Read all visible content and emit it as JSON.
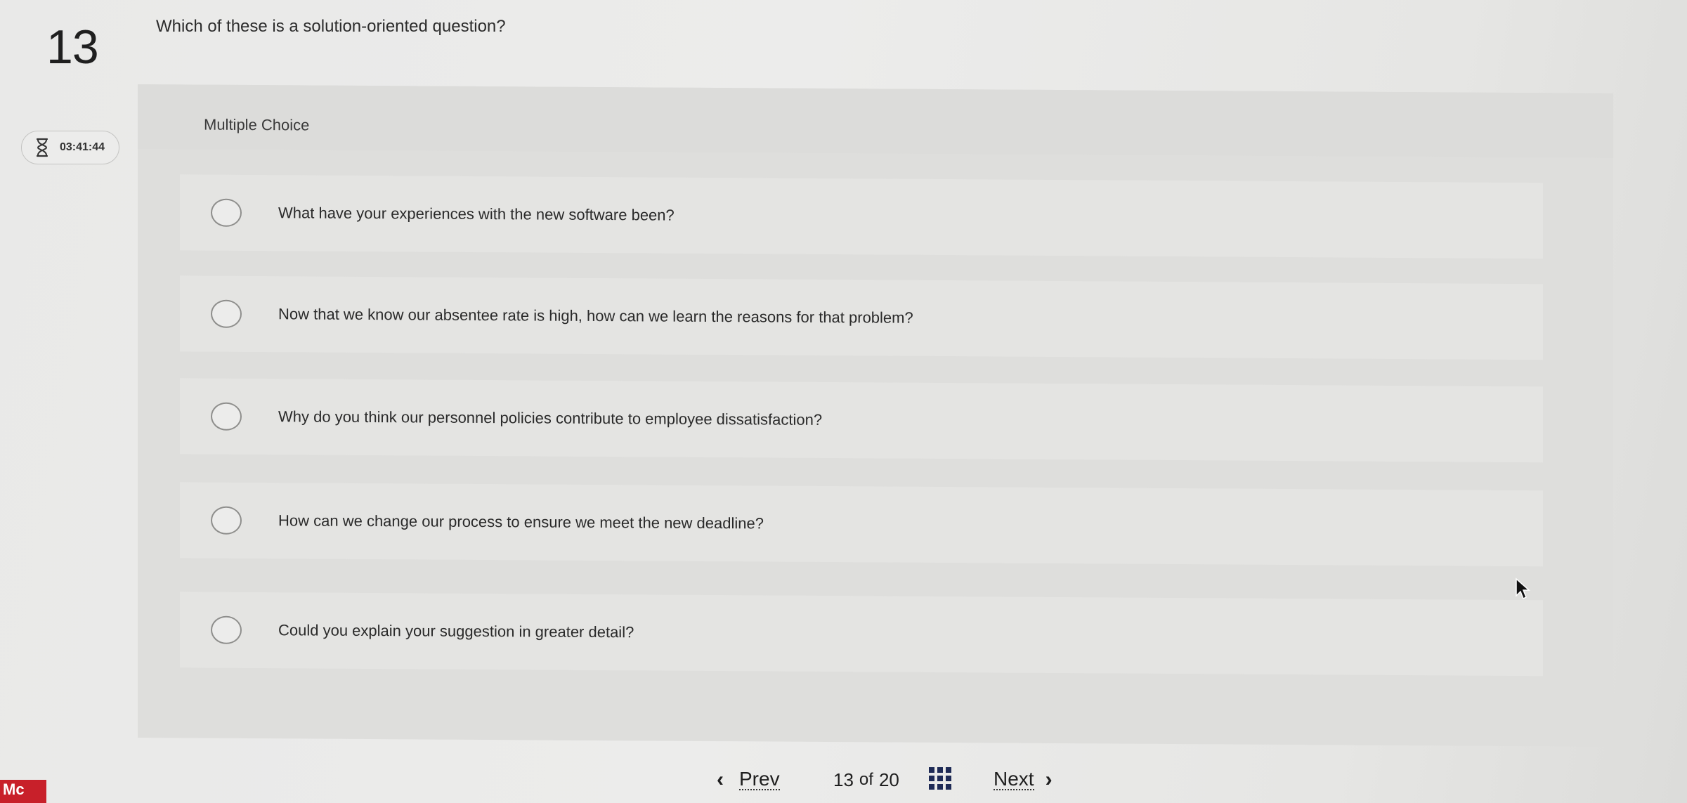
{
  "question": {
    "number": "13",
    "text": "Which of these is a solution-oriented question?"
  },
  "timer": {
    "icon": "hourglass-icon",
    "time": "03:41:44"
  },
  "panel": {
    "label": "Multiple Choice"
  },
  "options": [
    {
      "text": "What have your experiences with the new software been?"
    },
    {
      "text": "Now that we know our absentee rate is high, how can we learn the reasons for that problem?"
    },
    {
      "text": "Why do you think our personnel policies contribute to employee dissatisfaction?"
    },
    {
      "text": "How can we change our process to ensure we meet the new deadline?"
    },
    {
      "text": "Could you explain your suggestion in greater detail?"
    }
  ],
  "footer": {
    "logo": "Mc",
    "prev_label": "Prev",
    "next_label": "Next",
    "current_page": "13",
    "of_label": "of",
    "total_pages": "20"
  },
  "colors": {
    "logo_red": "#c8202a",
    "grid_icon": "#1e2a55"
  }
}
